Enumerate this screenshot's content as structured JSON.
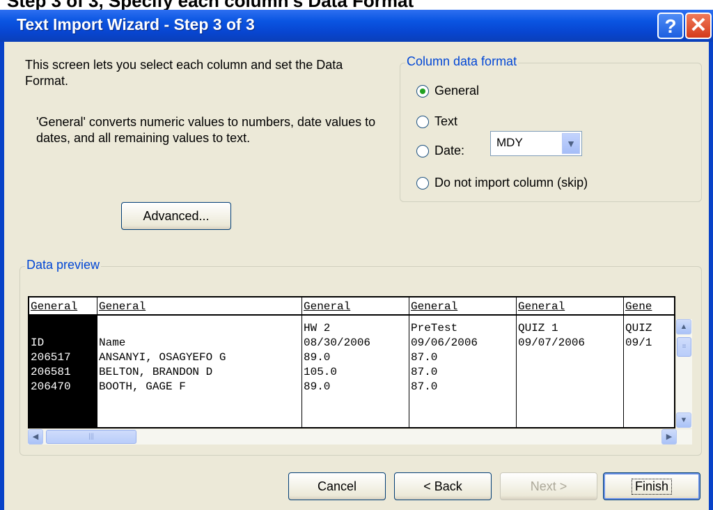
{
  "top_caption": "Step 3 of 3, Specify each column's Data Format",
  "window": {
    "title": "Text Import Wizard - Step 3 of 3",
    "help_label": "?",
    "close_label": "✕"
  },
  "intro": {
    "line1": "This screen lets you select each column and set the Data Format.",
    "line2": "'General' converts numeric values to numbers, date values to dates, and all remaining values to text."
  },
  "advanced_button": "Advanced...",
  "column_format": {
    "legend": "Column data format",
    "options": [
      {
        "label": "General",
        "checked": true
      },
      {
        "label": "Text",
        "checked": false
      },
      {
        "label": "Date:",
        "checked": false
      },
      {
        "label": "Do not import column (skip)",
        "checked": false
      }
    ],
    "date_value": "MDY"
  },
  "preview": {
    "legend": "Data preview",
    "columns": [
      {
        "header": "General",
        "selected": true,
        "cells": [
          "",
          "ID",
          "206517",
          "206581",
          "206470"
        ]
      },
      {
        "header": "General",
        "selected": false,
        "cells": [
          "",
          "Name",
          "ANSANYI, OSAGYEFO G",
          "BELTON, BRANDON D",
          "BOOTH, GAGE F"
        ]
      },
      {
        "header": "General",
        "selected": false,
        "cells": [
          "HW 2",
          "08/30/2006",
          "89.0",
          "105.0",
          "89.0"
        ]
      },
      {
        "header": "General",
        "selected": false,
        "cells": [
          "PreTest",
          "09/06/2006",
          "87.0",
          "87.0",
          "87.0"
        ]
      },
      {
        "header": "General",
        "selected": false,
        "cells": [
          "QUIZ 1",
          "09/07/2006",
          "",
          "",
          ""
        ]
      },
      {
        "header": "Gene",
        "selected": false,
        "cells": [
          "QUIZ",
          "09/1",
          "",
          "",
          ""
        ]
      }
    ]
  },
  "buttons": {
    "cancel": "Cancel",
    "back": "< Back",
    "next": "Next >",
    "finish": "Finish"
  },
  "icons": {
    "up": "▲",
    "down": "▼",
    "left": "◀",
    "right": "▶",
    "grip": "≡",
    "hgrip": "|||",
    "dropdown": "▼"
  }
}
